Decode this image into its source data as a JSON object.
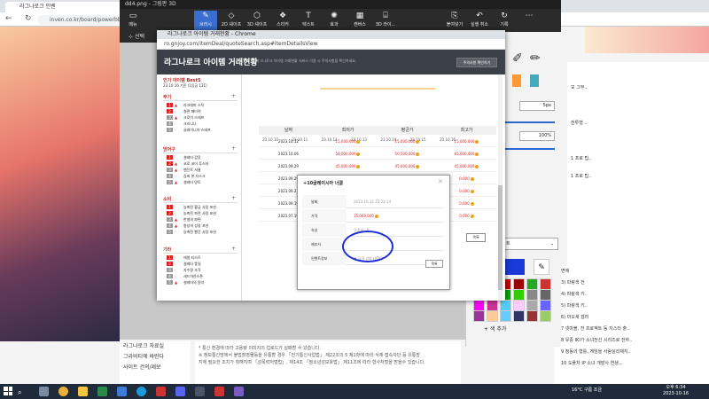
{
  "background_browser": {
    "tab_title": "라그나로크 인벤",
    "url": "inven.co.kr/board/powerbbs",
    "left_links": [
      "라그나로크 자료실",
      "그라비티에 바란다",
      "사이트 건의/제보"
    ],
    "notice_lines": [
      "* 통신 환경에 따라 고용량 이미지의 업로드가 실패할 수 있습니다.",
      "※ 정보통신망에서 불법촬영물등을 유통할 경우 「전기통신사업법」 제22조의 5 제1항에 따라 삭제·접속차단 등 유통방",
      "지에 필요한 조치가 취해지며 「성폭력처벌법」, 제14조 「청소년성보호법」 제11조에 따라 형사처벌을 받을수 있습니다."
    ],
    "right_list": [
      "면에",
      "3) 파랑색 전",
      "4) 파랑색 키..",
      "5) 파랑색 키..",
      "6) 마오새 갤러",
      "7 넷마블, 전 프로젝트 등 지스타 출..",
      "8 유중 IKI가 소녀전선 시리즈로 전하..",
      "9 정동의 형틀, 게임을 사람실리제지..",
      "10 도플차 IP 소녀 개발사 연생..."
    ],
    "add_color_label": "+ 색 추가",
    "right_items": [
      "7 조형된 ..",
      "모 그부..",
      "전투형 ..",
      "1 프로 팁..",
      "1 프로 팁..",
      "트"
    ]
  },
  "paint3d": {
    "title": "dd4.png - 그림판 3D",
    "menu_label": "메뉴",
    "select_label": "선택",
    "tools": [
      {
        "glyph": "✎",
        "label": "브러시",
        "active": true
      },
      {
        "glyph": "◇",
        "label": "2D 셰이프",
        "active": false
      },
      {
        "glyph": "⬡",
        "label": "3D 셰이프",
        "active": false
      },
      {
        "glyph": "❖",
        "label": "스티커",
        "active": false
      },
      {
        "glyph": "T",
        "label": "텍스트",
        "active": false
      },
      {
        "glyph": "✺",
        "label": "효과",
        "active": false
      },
      {
        "glyph": "▦",
        "label": "캔버스",
        "active": false
      },
      {
        "glyph": "⌸",
        "label": "3D 라이...",
        "active": false
      }
    ],
    "right_tools": [
      {
        "glyph": "⎘",
        "label": "붙여넣기"
      },
      {
        "glyph": "↶",
        "label": "실행 취소"
      },
      {
        "glyph": "↻",
        "label": "기록"
      },
      {
        "glyph": "⋯",
        "label": ""
      }
    ],
    "panel": {
      "thickness": "5px",
      "opacity": "100%"
    }
  },
  "popup": {
    "window_title": "라그나로크 아이템 거래현황 - Chrome",
    "url": "ro.gnjoy.com/itemDeal/quoteSearch.asp#itemDetailsView",
    "header_title": "라그나로크 아이템 거래현황",
    "header_sub": "라그나로크 아이템 거래현황 서비스 이용 시 주의사항을 확인하세요.",
    "header_button": "주의사항 확인하기",
    "popular_title": "인기 아이템 Best5",
    "popular_date": "23.10.16 기준 (1등급 12Σ)",
    "sections": [
      {
        "title": "무기",
        "rows": [
          {
            "n": "1",
            "d": "▲",
            "name": "라크레마 스틱"
          },
          {
            "n": "2",
            "d": "-",
            "name": "칠면 페티쉬"
          },
          {
            "n": "3",
            "d": "▲",
            "name": "크로이 스태프"
          },
          {
            "n": "4",
            "d": "-",
            "name": "크리니나"
          },
          {
            "n": "5",
            "d": "-",
            "name": "글레이니아 스태프"
          }
        ]
      },
      {
        "title": "방어구",
        "rows": [
          {
            "n": "1",
            "d": "-",
            "name": "셜레타 갑옷"
          },
          {
            "n": "2",
            "d": "▲",
            "name": "코로 코어 투스터"
          },
          {
            "n": "3",
            "d": "▲",
            "name": "펜던트 서뮬"
          },
          {
            "n": "4",
            "d": "-",
            "name": "갑싸 본 디스크"
          },
          {
            "n": "5",
            "d": "▲",
            "name": "셜레타 망토"
          }
        ]
      },
      {
        "title": "소비",
        "rows": [
          {
            "n": "1",
            "d": "-",
            "name": "농축된 황금 사탕 포션"
          },
          {
            "n": "2",
            "d": "-",
            "name": "농축된 파란 사탕 포션"
          },
          {
            "n": "3",
            "d": "▲",
            "name": "한넬의 파편"
          },
          {
            "n": "4",
            "d": "▲",
            "name": "향성의 성장 포션"
          },
          {
            "n": "5",
            "d": "-",
            "name": "농축된 빨간 사탕 포션"
          }
        ]
      },
      {
        "title": "기타",
        "rows": [
          {
            "n": "1",
            "d": "-",
            "name": "에멀 티스트"
          },
          {
            "n": "2",
            "d": "-",
            "name": "셜레타 풍일"
          },
          {
            "n": "3",
            "d": "-",
            "name": "자수정 조각"
          },
          {
            "n": "4",
            "d": "-",
            "name": "새드하얀스톤"
          },
          {
            "n": "5",
            "d": "▲",
            "name": "셜레타의 원석"
          }
        ]
      }
    ],
    "table_headers": [
      "날짜",
      "최저가",
      "평균가",
      "최고가"
    ],
    "table_rows": [
      {
        "date": "2023.10.12",
        "min": "15,000,000",
        "avg": "15,000,000",
        "max": "15,000,000"
      },
      {
        "date": "2023.10.06",
        "min": "50,000,000",
        "avg": "50,500,000",
        "max": "65,000,000"
      },
      {
        "date": "2023.09.29",
        "min": "45,000,000",
        "avg": "45,000,000",
        "max": "45,000,000"
      },
      {
        "date": "2023.09.29",
        "min": "",
        "avg": "",
        "max": "0,000"
      },
      {
        "date": "2023.09.21",
        "min": "",
        "avg": "",
        "max": "0,000"
      },
      {
        "date": "2023.09.19",
        "min": "",
        "avg": "",
        "max": "0,000"
      },
      {
        "date": "2023.07.19",
        "min": "",
        "avg": "",
        "max": "0,000"
      }
    ],
    "table_button": "목록",
    "modal": {
      "title": "+10글레이시아 너클",
      "close": "✕",
      "rows": [
        {
          "k": "날짜",
          "v": "2023.10.12 22:23:14",
          "red": false
        },
        {
          "k": "가격",
          "v": "15,000,000",
          "red": true
        },
        {
          "k": "속성",
          "v": "무속성 : 0",
          "red": false
        },
        {
          "k": "제조자",
          "v": "",
          "red": false
        },
        {
          "k": "인챈트정보",
          "v": "공격 강화 (ATK)",
          "red": false
        }
      ],
      "button": "목록"
    }
  },
  "chart_data": {
    "type": "line",
    "x": [
      "23.10.10",
      "23.10.11",
      "23.10.12",
      "23.10.13",
      "23.10.14",
      "23.10.15",
      "23.10.16"
    ],
    "series": [
      {
        "values": [
          15000000,
          15000000,
          15000000,
          15000000,
          15000000,
          15000000,
          15000000
        ]
      }
    ],
    "ylabel_tick": "0",
    "color": "#f0a030"
  },
  "taskbar": {
    "weather": "16°C 구름 조금",
    "time": "오후 6:34",
    "date": "2023-10-16"
  }
}
